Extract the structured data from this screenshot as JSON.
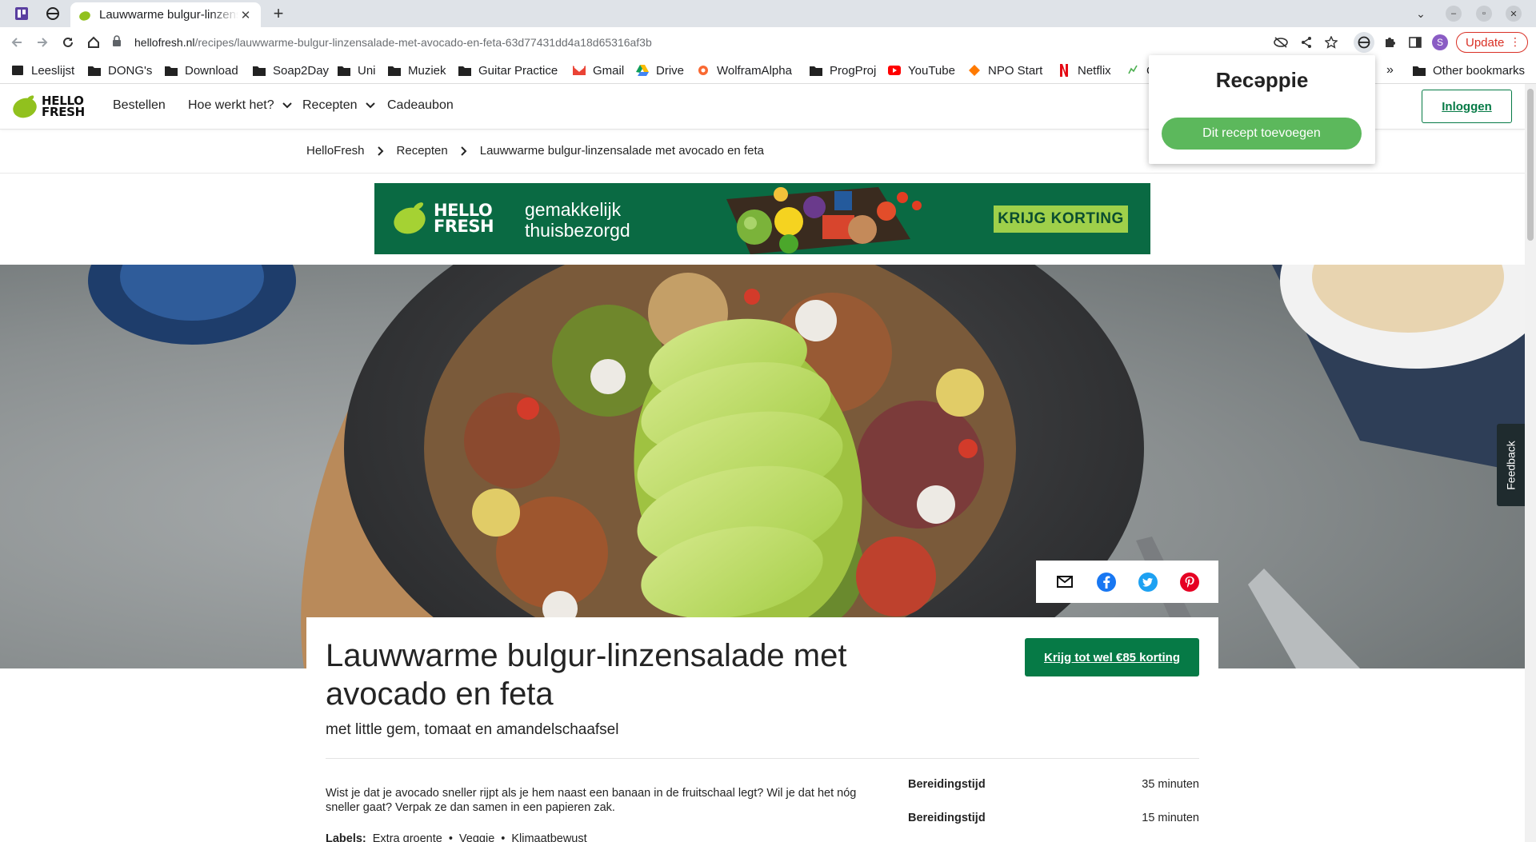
{
  "browser": {
    "tab_title": "Lauwwarme bulgur-linzensalade met avocado en feta",
    "url_host": "hellofresh.nl",
    "url_path": "/recipes/lauwwarme-bulgur-linzensalade-met-avocado-en-feta-63d77431dd4a18d65316af3b",
    "profile_initial": "S",
    "update_label": "Update"
  },
  "bookmarks": [
    {
      "label": "Leeslijst",
      "icon": "reading-list-icon"
    },
    {
      "label": "DONG's",
      "icon": "folder-icon"
    },
    {
      "label": "Download",
      "icon": "folder-icon"
    },
    {
      "label": "Soap2Day",
      "icon": "folder-icon"
    },
    {
      "label": "Uni",
      "icon": "folder-icon"
    },
    {
      "label": "Muziek",
      "icon": "folder-icon"
    },
    {
      "label": "Guitar Practice",
      "icon": "folder-icon"
    },
    {
      "label": "Gmail",
      "icon": "gmail-icon"
    },
    {
      "label": "Drive",
      "icon": "drive-icon"
    },
    {
      "label": "WolframAlpha",
      "icon": "wolfram-icon"
    },
    {
      "label": "ProgProj",
      "icon": "folder-icon"
    },
    {
      "label": "YouTube",
      "icon": "youtube-icon"
    },
    {
      "label": "NPO Start",
      "icon": "npo-icon"
    },
    {
      "label": "Netflix",
      "icon": "netflix-icon"
    },
    {
      "label": "C",
      "icon": "site-icon"
    }
  ],
  "bookmarks_overflow": "»",
  "other_bookmarks": "Other bookmarks",
  "site": {
    "logo_line1": "HELLO",
    "logo_line2": "FRESH",
    "nav": [
      "Bestellen",
      "Hoe werkt het?",
      "Recepten",
      "Cadeaubon"
    ],
    "login": "Inloggen"
  },
  "breadcrumb": [
    "HelloFresh",
    "Recepten",
    "Lauwwarme bulgur-linzensalade met avocado en feta"
  ],
  "banner": {
    "logo_line1": "HELLO",
    "logo_line2": "FRESH",
    "tagline_1": "gemakkelijk",
    "tagline_2": "thuisbezorgd",
    "cta": "KRIJG KORTING"
  },
  "recipe": {
    "title": "Lauwwarme bulgur-linzensalade met avocado en feta",
    "subtitle": "met little gem, tomaat en amandelschaafsel",
    "discount_button": "Krijg tot wel €85 korting",
    "description": "Wist je dat je avocado sneller rijpt als je hem naast een banaan in de fruitschaal legt? Wil je dat het nóg sneller gaat? Verpak ze dan samen in een papieren zak.",
    "labels_title": "Labels:",
    "labels": [
      "Extra groente",
      "Veggie",
      "Klimaatbewust"
    ],
    "times": [
      {
        "key": "Bereidingstijd",
        "value": "35 minuten"
      },
      {
        "key": "Bereidingstijd",
        "value": "15 minuten"
      }
    ]
  },
  "feedback": "Feedback",
  "extension_popup": {
    "title": "Recəppie",
    "button": "Dit recept toevoegen"
  },
  "colors": {
    "hf_green": "#067a46",
    "hf_lime": "#91c11e",
    "banner_bg": "#0a6a43",
    "popup_button": "#5cb85c",
    "update_red": "#d93025"
  }
}
